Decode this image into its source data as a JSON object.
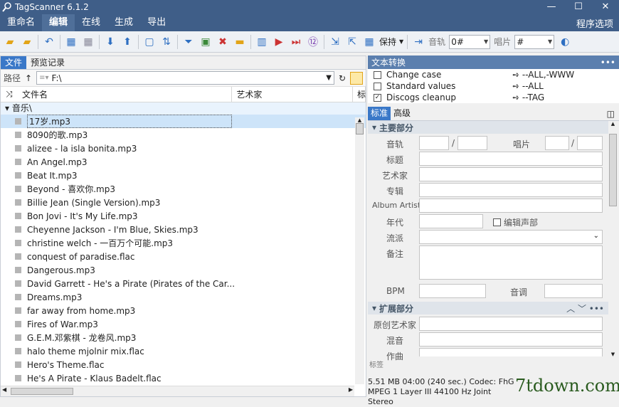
{
  "window": {
    "title": "TagScanner 6.1.2"
  },
  "menu": {
    "items": [
      "重命名",
      "编辑",
      "在线",
      "生成",
      "导出"
    ],
    "right": "程序选项"
  },
  "toolbar": {
    "save_label": "保持",
    "track_label": "音轨",
    "track_value": "0#",
    "disc_label": "唱片",
    "disc_value": "#"
  },
  "left": {
    "tabs": [
      "文件",
      "预览记录"
    ],
    "path_label": "路径",
    "path_value": "F:\\",
    "columns": [
      "文件名",
      "艺术家",
      "标"
    ],
    "group": "音乐\\",
    "files": [
      "17岁.mp3",
      "8090的歌.mp3",
      "alizee - la isla bonita.mp3",
      "An Angel.mp3",
      "Beat It.mp3",
      "Beyond - 喜欢你.mp3",
      "Billie Jean (Single Version).mp3",
      "Bon Jovi - It's My Life.mp3",
      "Cheyenne Jackson - I'm Blue, Skies.mp3",
      "christine welch - 一百万个可能.mp3",
      "conquest of paradise.flac",
      "Dangerous.mp3",
      "David Garrett - He's a Pirate (Pirates of the Car...",
      "Dreams.mp3",
      "far away from home.mp3",
      "Fires of War.mp3",
      "G.E.M.邓紫棋 - 龙卷风.mp3",
      "halo theme mjolnir mix.flac",
      "Hero's Theme.flac",
      "He's A Pirate - Klaus Badelt.flac"
    ]
  },
  "right": {
    "text_convert_title": "文本转换",
    "convert_rows": [
      {
        "label": "Change case",
        "value": "--ALL,-WWW",
        "checked": false
      },
      {
        "label": "Standard values",
        "value": "--ALL",
        "checked": false
      },
      {
        "label": "Discogs cleanup",
        "value": "--TAG",
        "checked": true
      }
    ],
    "tabs": [
      "标准",
      "高级"
    ],
    "main_section": "主要部分",
    "ext_section": "扩展部分",
    "fields": {
      "track": "音轨",
      "disc": "唱片",
      "title": "标题",
      "artist": "艺术家",
      "album": "专辑",
      "album_artist": "Album Artist",
      "year": "年代",
      "compilation": "编辑声部",
      "genre": "流派",
      "comment": "备注",
      "bpm": "BPM",
      "key": "音调",
      "orig_artist": "原创艺术家",
      "remix": "混音",
      "composer": "作曲"
    },
    "footer_label": "标签"
  },
  "status": {
    "line1": "5.51 MB  04:00 (240 sec.)  Codec: FhG",
    "line2": "MPEG 1 Layer III  44100 Hz  Joint Stereo"
  },
  "watermark": "7tdown.com"
}
